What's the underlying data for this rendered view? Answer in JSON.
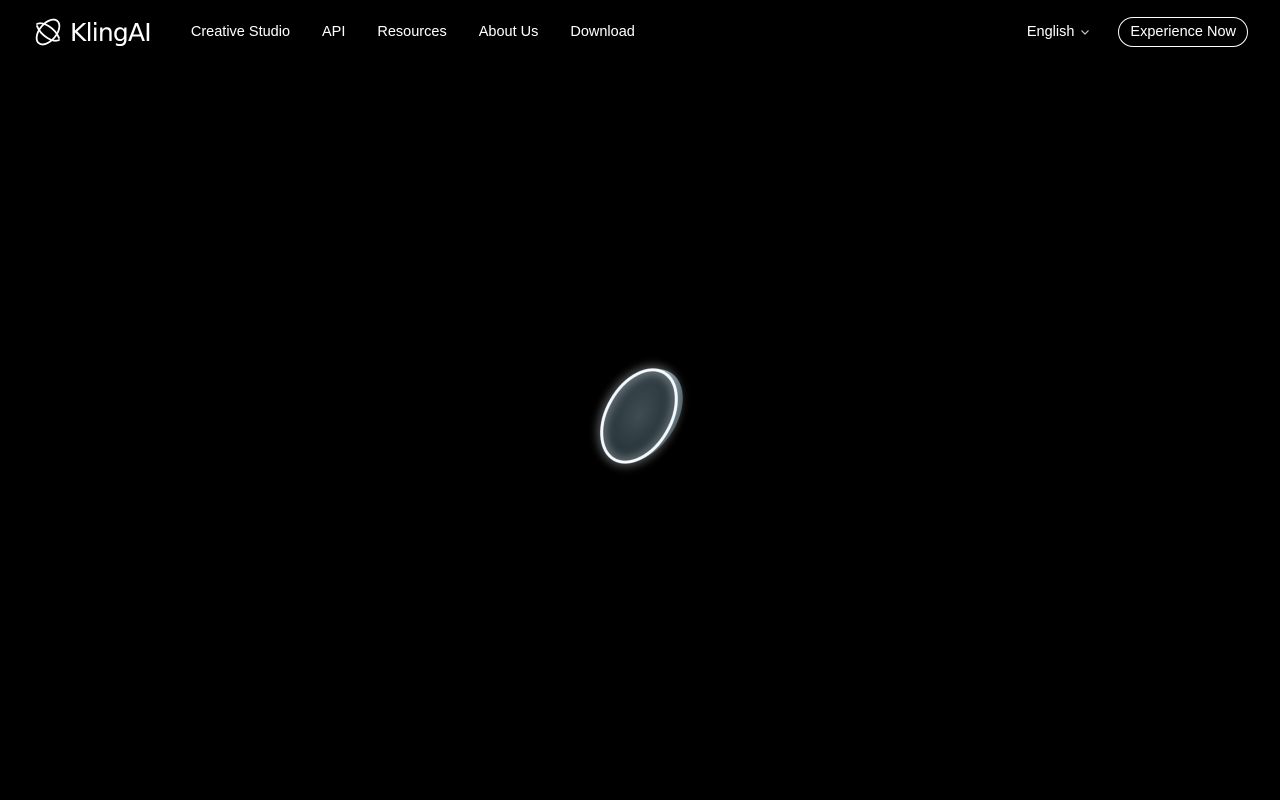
{
  "brand": {
    "name": "KlingAI",
    "logo_icon": "orbit-logo-icon"
  },
  "nav": {
    "items": [
      {
        "label": "Creative Studio"
      },
      {
        "label": "API"
      },
      {
        "label": "Resources"
      },
      {
        "label": "About Us"
      },
      {
        "label": "Download"
      }
    ]
  },
  "header_right": {
    "language": "English",
    "language_icon": "chevron-down-icon",
    "cta_label": "Experience Now"
  },
  "loader": {
    "icon": "glowing-ring-loader-icon"
  },
  "colors": {
    "background": "#000000",
    "text": "#ffffff",
    "ring_glow": "#e8f4ff",
    "ring_fill": "#5f7a85"
  }
}
